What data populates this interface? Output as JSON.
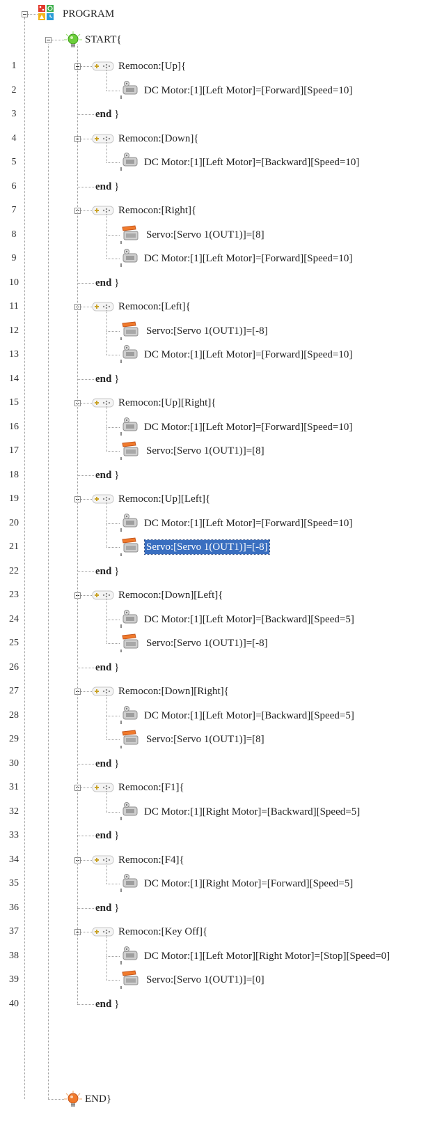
{
  "tree": {
    "root_label": "PROGRAM",
    "start_label": "START{",
    "end_label": "END}",
    "end_keyword": "end",
    "end_brace": "}",
    "blocks": [
      {
        "label": "Remocon:[Up]{",
        "children": [
          {
            "type": "dc-motor",
            "label": "DC Motor:[1][Left Motor]=[Forward][Speed=10]"
          }
        ]
      },
      {
        "label": "Remocon:[Down]{",
        "children": [
          {
            "type": "dc-motor",
            "label": "DC Motor:[1][Left Motor]=[Backward][Speed=10]"
          }
        ]
      },
      {
        "label": "Remocon:[Right]{",
        "children": [
          {
            "type": "servo",
            "label": "Servo:[Servo 1(OUT1)]=[8]"
          },
          {
            "type": "dc-motor",
            "label": "DC Motor:[1][Left Motor]=[Forward][Speed=10]"
          }
        ]
      },
      {
        "label": "Remocon:[Left]{",
        "children": [
          {
            "type": "servo",
            "label": "Servo:[Servo 1(OUT1)]=[-8]"
          },
          {
            "type": "dc-motor",
            "label": "DC Motor:[1][Left Motor]=[Forward][Speed=10]"
          }
        ]
      },
      {
        "label": "Remocon:[Up][Right]{",
        "children": [
          {
            "type": "dc-motor",
            "label": "DC Motor:[1][Left Motor]=[Forward][Speed=10]"
          },
          {
            "type": "servo",
            "label": "Servo:[Servo 1(OUT1)]=[8]"
          }
        ]
      },
      {
        "label": "Remocon:[Up][Left]{",
        "children": [
          {
            "type": "dc-motor",
            "label": "DC Motor:[1][Left Motor]=[Forward][Speed=10]"
          },
          {
            "type": "servo",
            "label": "Servo:[Servo 1(OUT1)]=[-8]",
            "selected": true
          }
        ]
      },
      {
        "label": "Remocon:[Down][Left]{",
        "children": [
          {
            "type": "dc-motor",
            "label": "DC Motor:[1][Left Motor]=[Backward][Speed=5]"
          },
          {
            "type": "servo",
            "label": "Servo:[Servo 1(OUT1)]=[-8]"
          }
        ]
      },
      {
        "label": "Remocon:[Down][Right]{",
        "children": [
          {
            "type": "dc-motor",
            "label": "DC Motor:[1][Left Motor]=[Backward][Speed=5]"
          },
          {
            "type": "servo",
            "label": "Servo:[Servo 1(OUT1)]=[8]"
          }
        ]
      },
      {
        "label": "Remocon:[F1]{",
        "children": [
          {
            "type": "dc-motor",
            "label": "DC Motor:[1][Right Motor]=[Backward][Speed=5]"
          }
        ]
      },
      {
        "label": "Remocon:[F4]{",
        "children": [
          {
            "type": "dc-motor",
            "label": "DC Motor:[1][Right Motor]=[Forward][Speed=5]"
          }
        ]
      },
      {
        "label": "Remocon:[Key Off]{",
        "children": [
          {
            "type": "dc-motor",
            "label": "DC Motor:[1][Left Motor][Right Motor]=[Stop][Speed=0]"
          },
          {
            "type": "servo",
            "label": "Servo:[Servo 1(OUT1)]=[0]"
          }
        ]
      }
    ]
  },
  "colors": {
    "selection": "#3a6fc0",
    "tree_line": "#9a9a9a"
  }
}
